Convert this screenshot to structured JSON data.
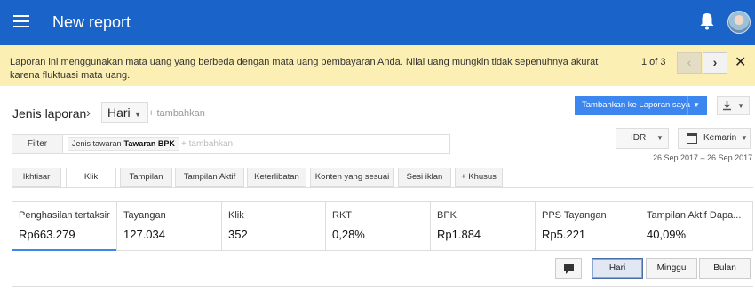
{
  "header": {
    "title": "New report",
    "background": "#1a63c9"
  },
  "banner": {
    "message": "Laporan ini menggunakan mata uang yang berbeda dengan mata uang pembayaran Anda. Nilai uang mungkin tidak sepenuhnya akurat karena fluktuasi mata uang.",
    "pager": "1 of 3",
    "prev_icon": "‹",
    "next_icon": "›",
    "close_icon": "✕",
    "background": "#fcefb4"
  },
  "report": {
    "type_label": "Jenis laporan",
    "chevron": "›",
    "type_value": "Hari",
    "add_label": "+ tambahkan",
    "add_to_report_button": "Tambahkan ke Laporan saya"
  },
  "filter": {
    "button_label": "Filter",
    "chip_key": "Jenis tawaran",
    "chip_value": "Tawaran BPK",
    "add_label": "+ tambahkan"
  },
  "currency": {
    "value": "IDR"
  },
  "date": {
    "value": "Kemarin",
    "range": "26 Sep 2017 – 26 Sep 2017"
  },
  "tabs": [
    {
      "label": "Ikhtisar"
    },
    {
      "label": "Klik",
      "active": true
    },
    {
      "label": "Tampilan"
    },
    {
      "label": "Tampilan Aktif"
    },
    {
      "label": "Keterlibatan"
    },
    {
      "label": "Konten yang sesuai"
    },
    {
      "label": "Sesi iklan"
    },
    {
      "label": "+ Khusus"
    }
  ],
  "metrics": [
    {
      "label": "Penghasilan tertaksir",
      "value": "Rp663.279",
      "active": true
    },
    {
      "label": "Tayangan",
      "value": "127.034"
    },
    {
      "label": "Klik",
      "value": "352"
    },
    {
      "label": "RKT",
      "value": "0,28%"
    },
    {
      "label": "BPK",
      "value": "Rp1.884"
    },
    {
      "label": "PPS Tayangan",
      "value": "Rp5.221"
    },
    {
      "label": "Tampilan Aktif Dapa...",
      "value": "40,09%"
    }
  ],
  "period": {
    "options": [
      "Hari",
      "Minggu",
      "Bulan"
    ],
    "selected": "Hari"
  },
  "colors": {
    "accent": "#3c86ef"
  }
}
